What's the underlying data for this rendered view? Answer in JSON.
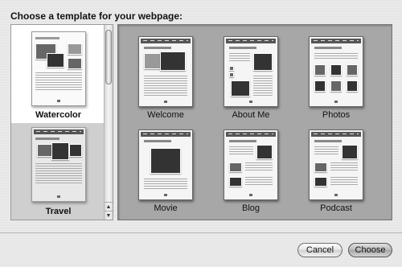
{
  "dialog": {
    "title": "Choose a template for your webpage:"
  },
  "themes": [
    {
      "label": "Watercolor",
      "selected": true
    },
    {
      "label": "Travel",
      "selected": false
    }
  ],
  "templates": [
    {
      "label": "Welcome"
    },
    {
      "label": "About Me"
    },
    {
      "label": "Photos"
    },
    {
      "label": "Movie"
    },
    {
      "label": "Blog"
    },
    {
      "label": "Podcast"
    }
  ],
  "scrollbar": {
    "up_icon": "arrow-up-icon",
    "down_icon": "arrow-down-icon"
  },
  "buttons": {
    "cancel_label": "Cancel",
    "choose_label": "Choose"
  },
  "colors": {
    "preview_background": "#a7a7a7",
    "selected_theme_background": "#ffffff",
    "unselected_theme_background": "#cfcfcf"
  }
}
